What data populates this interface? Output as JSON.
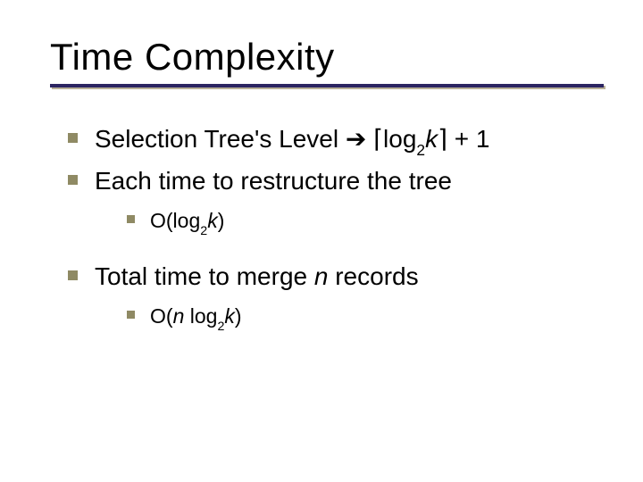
{
  "title": "Time Complexity",
  "bullets": {
    "b1_prefix": "Selection Tree's Level ",
    "b1_arrow": "➔",
    "b1_ceil_open": "⌈",
    "b1_log": "log",
    "b1_base": "2",
    "b1_k": "k",
    "b1_ceil_close": "⌉",
    "b1_suffix": " + 1",
    "b2": "Each time to restructure the tree",
    "b2_sub_prefix": "O(log",
    "b2_sub_base": "2",
    "b2_sub_k": "k",
    "b2_sub_suffix": ")",
    "b3_prefix": "Total time to merge ",
    "b3_n": "n",
    "b3_suffix": " records",
    "b3_sub_prefix": "O(",
    "b3_sub_n": "n",
    "b3_sub_mid": " log",
    "b3_sub_base": "2",
    "b3_sub_k": "k",
    "b3_sub_suffix": ")"
  }
}
